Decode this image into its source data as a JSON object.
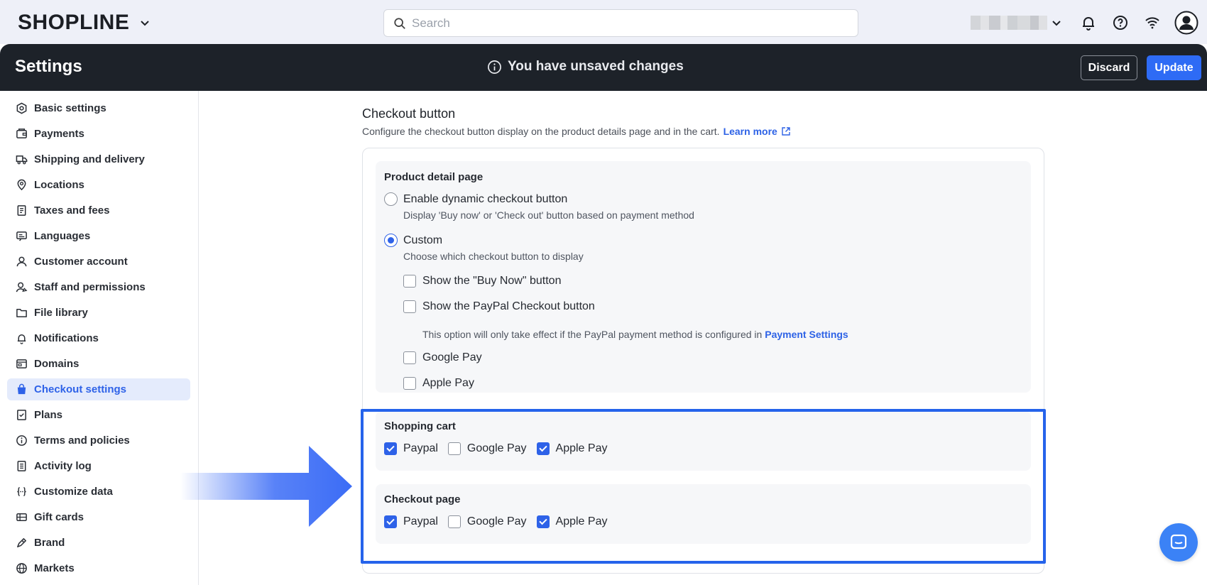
{
  "topbar": {
    "logo": "SHOPLINE",
    "search_placeholder": "Search",
    "icons": [
      "chevron-down-icon",
      "search-icon",
      "bell-icon",
      "help-icon",
      "wifi-icon",
      "user-avatar-icon"
    ]
  },
  "header": {
    "title": "Settings",
    "unsaved_text": "You have unsaved changes",
    "discard_label": "Discard",
    "update_label": "Update"
  },
  "sidebar": {
    "items": [
      {
        "label": "Basic settings",
        "icon": "gear-hex-icon"
      },
      {
        "label": "Payments",
        "icon": "wallet-icon"
      },
      {
        "label": "Shipping and delivery",
        "icon": "truck-icon"
      },
      {
        "label": "Locations",
        "icon": "location-pin-icon"
      },
      {
        "label": "Taxes and fees",
        "icon": "receipt-icon"
      },
      {
        "label": "Languages",
        "icon": "language-icon"
      },
      {
        "label": "Customer account",
        "icon": "person-icon"
      },
      {
        "label": "Staff and permissions",
        "icon": "staff-icon"
      },
      {
        "label": "File library",
        "icon": "folder-icon"
      },
      {
        "label": "Notifications",
        "icon": "bell-icon"
      },
      {
        "label": "Domains",
        "icon": "browser-icon"
      },
      {
        "label": "Checkout settings",
        "icon": "shopping-bag-icon",
        "active": true
      },
      {
        "label": "Plans",
        "icon": "plans-icon"
      },
      {
        "label": "Terms and policies",
        "icon": "info-icon"
      },
      {
        "label": "Activity log",
        "icon": "log-icon"
      },
      {
        "label": "Customize data",
        "icon": "braces-icon"
      },
      {
        "label": "Gift cards",
        "icon": "gift-card-icon"
      },
      {
        "label": "Brand",
        "icon": "brand-icon"
      },
      {
        "label": "Markets",
        "icon": "globe-icon"
      }
    ]
  },
  "checkout_button": {
    "title": "Checkout button",
    "description": "Configure the checkout button display on the product details page and in the cart.",
    "learn_more": "Learn more",
    "product_detail": {
      "title": "Product detail page",
      "dynamic_label": "Enable dynamic checkout button",
      "dynamic_hint": "Display 'Buy now' or 'Check out' button based on payment method",
      "dynamic_selected": false,
      "custom_label": "Custom",
      "custom_hint": "Choose which checkout button to display",
      "custom_selected": true,
      "options": {
        "buy_now": {
          "label": "Show the \"Buy Now\" button",
          "checked": false
        },
        "paypal": {
          "label": "Show the PayPal Checkout button",
          "checked": false
        },
        "paypal_hint": "This option will only take effect if the PayPal payment method is configured in",
        "paypal_hint_link": "Payment Settings",
        "google_pay": {
          "label": "Google Pay",
          "checked": false
        },
        "apple_pay": {
          "label": "Apple Pay",
          "checked": false
        }
      }
    },
    "shopping_cart": {
      "title": "Shopping cart",
      "paypal": {
        "label": "Paypal",
        "checked": true
      },
      "google_pay": {
        "label": "Google Pay",
        "checked": false
      },
      "apple_pay": {
        "label": "Apple Pay",
        "checked": true
      }
    },
    "checkout_page": {
      "title": "Checkout page",
      "paypal": {
        "label": "Paypal",
        "checked": true
      },
      "google_pay": {
        "label": "Google Pay",
        "checked": false
      },
      "apple_pay": {
        "label": "Apple Pay",
        "checked": true
      }
    }
  },
  "colors": {
    "accent": "#2e62e8",
    "header_bg": "#1d2229",
    "highlight": "#2563eb"
  }
}
